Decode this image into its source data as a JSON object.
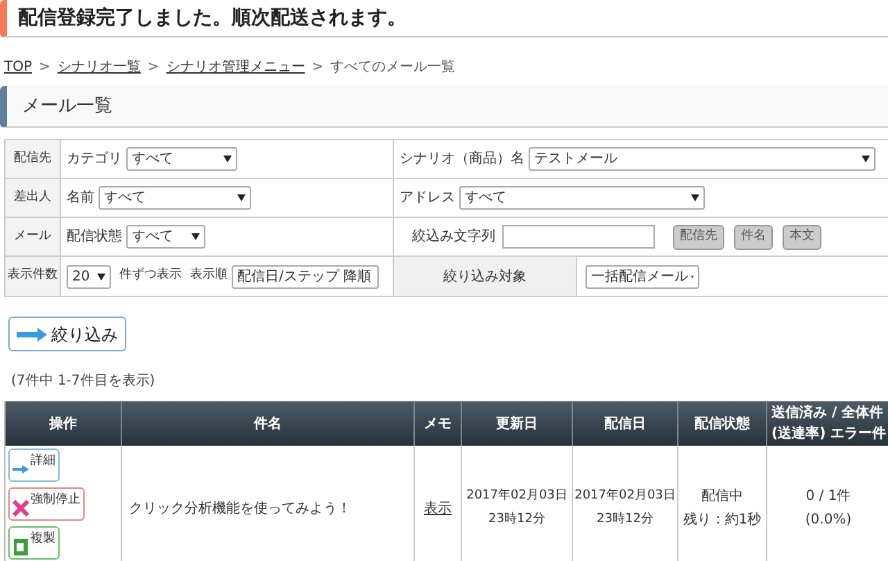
{
  "alert": "配信登録完了しました。順次配送されます。",
  "breadcrumb": [
    {
      "label": "TOP",
      "link": true
    },
    {
      "label": "シナリオ一覧",
      "link": true
    },
    {
      "label": "シナリオ管理メニュー",
      "link": true
    },
    {
      "label": "すべてのメール一覧",
      "link": false
    }
  ],
  "breadcrumb_separator": ">",
  "section_title": "メール一覧",
  "filters": [
    {
      "label": "配信先",
      "left": {
        "kind": "select",
        "label": "カテゴリ",
        "value": "すべて"
      },
      "right": {
        "kind": "select",
        "label": "シナリオ（商品）名",
        "value": "テストメール"
      }
    },
    {
      "label": "差出人",
      "left": {
        "kind": "select",
        "label": "名前",
        "value": "すべて"
      },
      "right": {
        "kind": "select",
        "label": "アドレス",
        "value": "すべて"
      }
    },
    {
      "label": "メール",
      "left": {
        "kind": "select",
        "label": "配信状態",
        "value": "すべて"
      },
      "right": {
        "kind": "search",
        "label": "絞込み文字列",
        "buttons": [
          "配信先",
          "件名",
          "本文"
        ]
      }
    },
    {
      "label": "表示件数",
      "left": {
        "kind": "perpage",
        "value": "20",
        "suffix": "件ずつ表示",
        "sort_label": "表示順",
        "sort_value": "配信日/ステップ 降順"
      },
      "right": {
        "kind": "target",
        "label": "絞り込み対象",
        "value": "一括配信メール"
      }
    }
  ],
  "filter_button": "絞り込み",
  "result_count": "(7件中 1-7件目を表示)",
  "table": {
    "columns": [
      "操作",
      "件名",
      "メモ",
      "更新日",
      "配信日",
      "配信状態",
      "送信済み / 全体件\n(送達率) エラー件"
    ],
    "rows": [
      {
        "actions": [
          {
            "kind": "detail",
            "label": "詳細"
          },
          {
            "kind": "stop",
            "label": "強制停止"
          },
          {
            "kind": "copy",
            "label": "複製"
          }
        ],
        "subject": "クリック分析機能を使ってみよう！",
        "memo": "表示",
        "updated": "2017年02月03日\n23時12分",
        "sent": "2017年02月03日\n23時12分",
        "status": [
          "配信中",
          "残り：約1秒"
        ],
        "counts": "0 / 1件\n(0.0%)"
      }
    ]
  }
}
